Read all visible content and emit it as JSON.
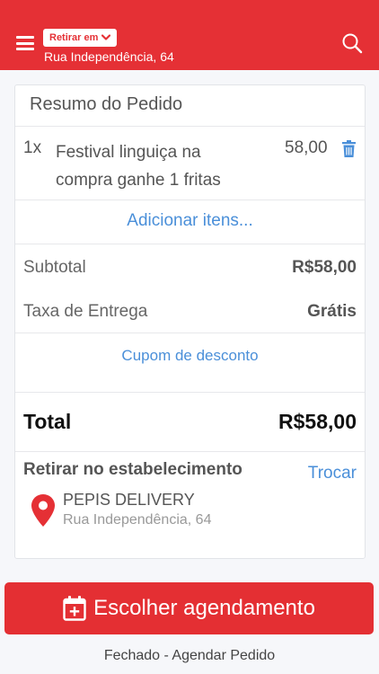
{
  "header": {
    "mode_label": "Retirar em",
    "address": "Rua Independência, 64",
    "brand_color": "#e53035",
    "icons": [
      "menu-icon",
      "chevron-down-icon",
      "search-icon"
    ]
  },
  "order_summary": {
    "title": "Resumo do Pedido",
    "items": [
      {
        "qty": "1x",
        "name": "Festival linguiça na compra ganhe 1 fritas",
        "price": "58,00",
        "remove_icon": "trash-icon"
      }
    ],
    "add_items_label": "Adicionar itens...",
    "subtotal_label": "Subtotal",
    "subtotal_value": "R$58,00",
    "delivery_fee_label": "Taxa de Entrega",
    "delivery_fee_value": "Grátis",
    "coupon_label": "Cupom de desconto",
    "total_label": "Total",
    "total_value": "R$58,00",
    "link_color": "#4a8fd9"
  },
  "pickup": {
    "title": "Retirar no estabelecimento",
    "change_label": "Trocar",
    "store_name": "PEPIS DELIVERY",
    "store_address": "Rua Independência, 64",
    "icon": "map-pin-icon"
  },
  "cta": {
    "label": "Escolher agendamento",
    "icon": "calendar-plus-icon",
    "color": "#e42f33"
  },
  "footer": {
    "status_text": "Fechado - Agendar Pedido"
  }
}
